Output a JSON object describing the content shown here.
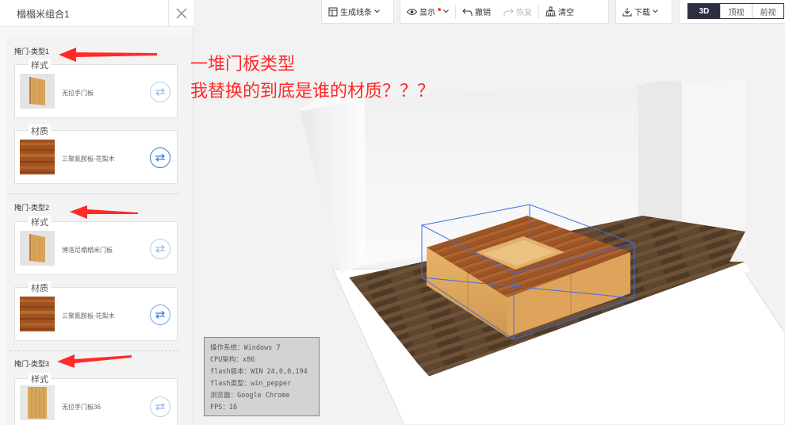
{
  "panel": {
    "title": "榻榻米组合1",
    "groups": [
      {
        "title": "掩门-类型1",
        "style": {
          "label": "样式",
          "name": "无拉手门板"
        },
        "material": {
          "label": "材质",
          "name": "三聚氰胺板-花梨木"
        }
      },
      {
        "title": "掩门-类型2",
        "style": {
          "label": "样式",
          "name": "博洛尼榻榻米门板"
        },
        "material": {
          "label": "材质",
          "name": "三聚氰胺板-花梨木"
        }
      },
      {
        "title": "掩门-类型3",
        "style": {
          "label": "样式",
          "name": "无拉手门板36"
        }
      }
    ]
  },
  "toolbar": {
    "generate_lines": "生成线条",
    "display": "显示",
    "undo": "撤销",
    "redo": "恢复",
    "clear": "清空",
    "download": "下载",
    "views": [
      "3D",
      "顶视",
      "前视"
    ],
    "active_view": "3D"
  },
  "annotation": {
    "line1": "一堆门板类型",
    "line2": "我替换的到底是谁的材质？？？"
  },
  "system_info": [
    "操作系统：Windows 7",
    "CPU架构：x86",
    "flash版本：WIN 24,0,0,194",
    "flash类型：win_pepper",
    "浏览器：Google Chrome",
    "FPS：16"
  ],
  "colors": {
    "annotation": "#ff2a2a",
    "accent": "#3a7bd5",
    "active_view_bg": "#2b3140",
    "wood_light": "#d9a35a",
    "wood_dark": "#8a4a20",
    "floor": "#5e4630"
  }
}
